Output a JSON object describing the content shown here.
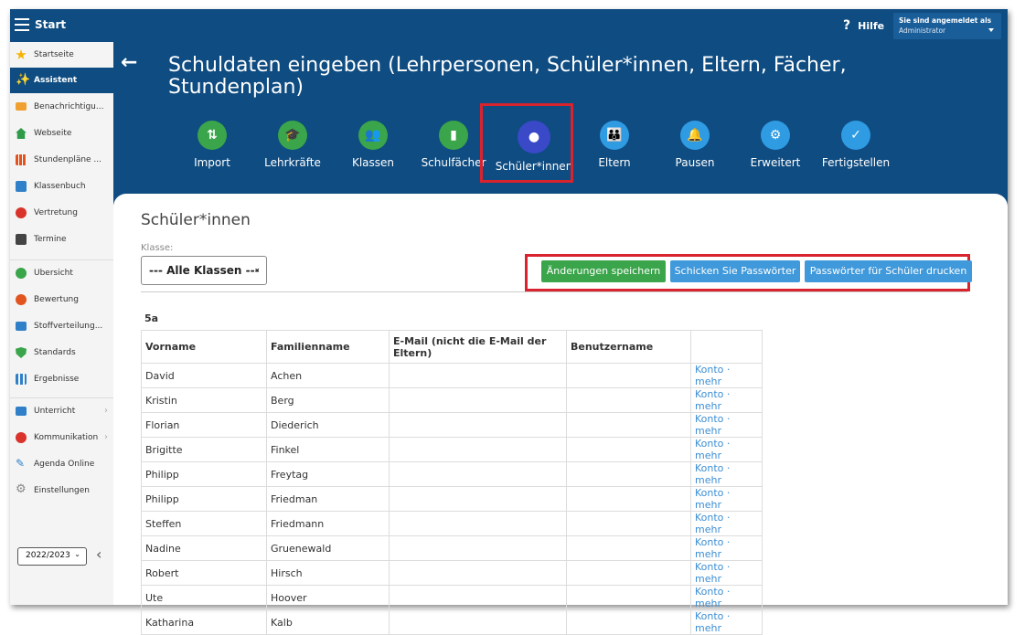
{
  "topbar": {
    "title": "Start",
    "help": "Hilfe",
    "user_line1": "Sie sind angemeldet als",
    "user_line2": "Administrator"
  },
  "sidebar": {
    "items": [
      {
        "label": "Startseite",
        "icon": "star-icon",
        "color": "#f5b301"
      },
      {
        "label": "Assistent",
        "icon": "magic-wand-icon",
        "color": "#ffffff"
      },
      {
        "label": "Benachrichtigu...",
        "icon": "envelope-icon",
        "color": "#f0a030"
      },
      {
        "label": "Webseite",
        "icon": "home-icon",
        "color": "#2e9b49"
      },
      {
        "label": "Stundenpläne ...",
        "icon": "calendar-grid-icon",
        "color": "#e2541f"
      },
      {
        "label": "Klassenbuch",
        "icon": "book-icon",
        "color": "#2f80c8"
      },
      {
        "label": "Vertretung",
        "icon": "person-swap-icon",
        "color": "#d9332b"
      },
      {
        "label": "Termine",
        "icon": "calendar-icon",
        "color": "#444444"
      },
      {
        "label": "Übersicht",
        "icon": "check-circle-icon",
        "color": "#3aa54a"
      },
      {
        "label": "Bewertung",
        "icon": "grade-icon",
        "color": "#e2541f"
      },
      {
        "label": "Stoffverteilung...",
        "icon": "briefcase-icon",
        "color": "#2f80c8"
      },
      {
        "label": "Standards",
        "icon": "shield-check-icon",
        "color": "#3aa54a"
      },
      {
        "label": "Ergebnisse",
        "icon": "bar-chart-icon",
        "color": "#2f80c8"
      },
      {
        "label": "Unterricht",
        "icon": "classroom-icon",
        "color": "#2f80c8"
      },
      {
        "label": "Kommunikation",
        "icon": "chat-users-icon",
        "color": "#d9332b"
      },
      {
        "label": "Agenda Online",
        "icon": "pen-icon",
        "color": "#2f80c8"
      },
      {
        "label": "Einstellungen",
        "icon": "gear-icon",
        "color": "#888888"
      }
    ],
    "year": "2022/2023"
  },
  "header": {
    "title": "Schuldaten eingeben (Lehrpersonen, Schüler*innen, Eltern, Fächer, Stundenplan)",
    "steps": [
      {
        "label": "Import",
        "icon": "import-arrows-icon",
        "color": "#3aa54a"
      },
      {
        "label": "Lehrkräfte",
        "icon": "graduation-cap-icon",
        "color": "#3aa54a"
      },
      {
        "label": "Klassen",
        "icon": "users-icon",
        "color": "#3aa54a"
      },
      {
        "label": "Schulfächer",
        "icon": "book-icon",
        "color": "#3aa54a"
      },
      {
        "label": "Schüler*innen",
        "icon": "user-icon",
        "color": "#3949c8"
      },
      {
        "label": "Eltern",
        "icon": "parents-icon",
        "color": "#2f9be3"
      },
      {
        "label": "Pausen",
        "icon": "bell-icon",
        "color": "#2f9be3"
      },
      {
        "label": "Erweitert",
        "icon": "gear-icon",
        "color": "#2f9be3"
      },
      {
        "label": "Fertigstellen",
        "icon": "check-icon",
        "color": "#2f9be3"
      }
    ]
  },
  "content": {
    "section_title": "Schüler*innen",
    "klasse_label": "Klasse:",
    "klasse_value": "--- Alle Klassen ---",
    "buttons": {
      "save": "Änderungen speichern",
      "send": "Schicken Sie Passwörter",
      "print": "Passwörter für Schüler drucken"
    },
    "class_name": "5a",
    "columns": [
      "Vorname",
      "Familienname",
      "E-Mail (nicht die E-Mail der Eltern)",
      "Benutzername",
      ""
    ],
    "link_konto": "Konto",
    "link_sep": "·",
    "link_mehr": "mehr",
    "rows": [
      {
        "first": "David",
        "last": "Achen"
      },
      {
        "first": "Kristin",
        "last": "Berg"
      },
      {
        "first": "Florian",
        "last": "Diederich"
      },
      {
        "first": "Brigitte",
        "last": "Finkel"
      },
      {
        "first": "Philipp",
        "last": "Freytag"
      },
      {
        "first": "Philipp",
        "last": "Friedman"
      },
      {
        "first": "Steffen",
        "last": "Friedmann"
      },
      {
        "first": "Nadine",
        "last": "Gruenewald"
      },
      {
        "first": "Robert",
        "last": "Hirsch"
      },
      {
        "first": "Ute",
        "last": "Hoover"
      },
      {
        "first": "Katharina",
        "last": "Kalb"
      }
    ]
  }
}
